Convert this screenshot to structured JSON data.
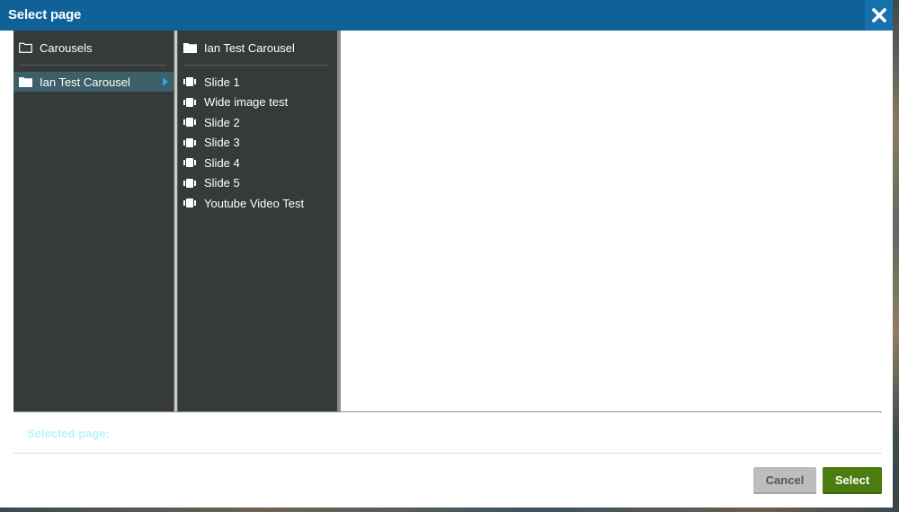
{
  "dialog": {
    "title": "Select page",
    "close_icon": "close-icon"
  },
  "columns": [
    {
      "header": {
        "label": "Carousels",
        "icon": "folder-outline-icon"
      },
      "items": [
        {
          "label": "Ian Test Carousel",
          "icon": "folder-icon",
          "selected": true,
          "has_children": true
        }
      ]
    },
    {
      "header": {
        "label": "Ian Test Carousel",
        "icon": "folder-icon"
      },
      "items": [
        {
          "label": "Slide 1",
          "icon": "slides-icon"
        },
        {
          "label": "Wide image test",
          "icon": "slides-icon"
        },
        {
          "label": "Slide 2",
          "icon": "slides-icon"
        },
        {
          "label": "Slide 3",
          "icon": "slides-icon"
        },
        {
          "label": "Slide 4",
          "icon": "slides-icon"
        },
        {
          "label": "Slide 5",
          "icon": "slides-icon"
        },
        {
          "label": "Youtube Video Test",
          "icon": "slides-icon"
        }
      ]
    }
  ],
  "footer": {
    "selected_page_label": "Selected page:",
    "selected_page_value": "",
    "cancel_label": "Cancel",
    "select_label": "Select"
  },
  "colors": {
    "titlebar": "#0f6198",
    "panel": "#363a3b",
    "selected_row": "#3d5f67",
    "arrow": "#2ea3f2",
    "select_button": "#4b7c0f",
    "cancel_button": "#bdbdbd",
    "selected_label": "#b8f4fb"
  }
}
